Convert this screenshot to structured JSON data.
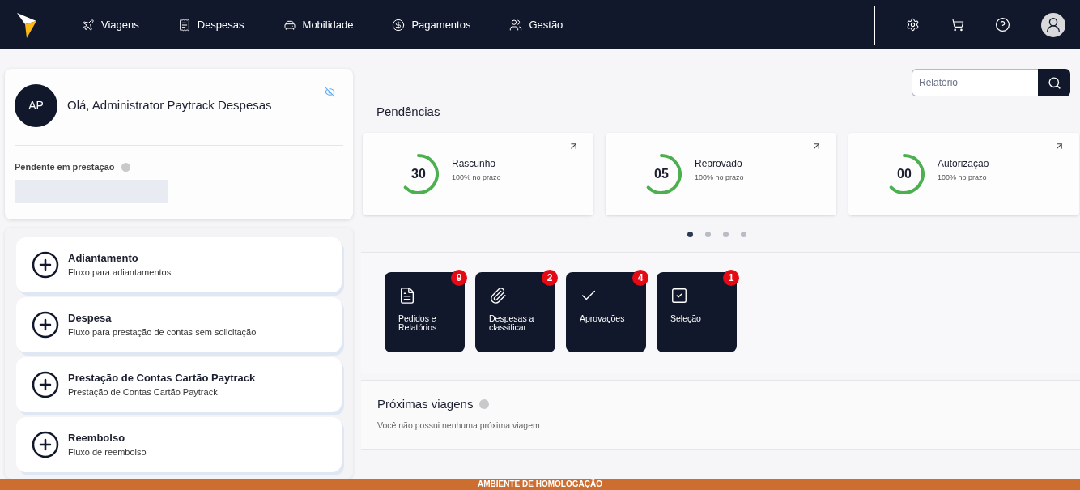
{
  "nav": [
    {
      "label": "Viagens"
    },
    {
      "label": "Despesas"
    },
    {
      "label": "Mobilidade"
    },
    {
      "label": "Pagamentos"
    },
    {
      "label": "Gestão"
    }
  ],
  "user": {
    "initials": "AP",
    "greeting": "Olá, Administrator Paytrack Despesas",
    "pending_label": "Pendente em prestação"
  },
  "flows": [
    {
      "title": "Adiantamento",
      "subtitle": "Fluxo para adiantamentos"
    },
    {
      "title": "Despesa",
      "subtitle": "Fluxo para prestação de contas sem solicitação"
    },
    {
      "title": "Prestação de Contas Cartão Paytrack",
      "subtitle": "Prestação de Contas Cartão Paytrack"
    },
    {
      "title": "Reembolso",
      "subtitle": "Fluxo de reembolso"
    }
  ],
  "search": {
    "placeholder": "Relatório"
  },
  "pendencias": {
    "title": "Pendências",
    "cards": [
      {
        "count": "30",
        "title": "Rascunho",
        "subtitle": "100% no prazo"
      },
      {
        "count": "05",
        "title": "Reprovado",
        "subtitle": "100% no prazo"
      },
      {
        "count": "00",
        "title": "Autorização",
        "subtitle": "100% no prazo"
      }
    ],
    "pages": [
      {
        "selected": true
      },
      {
        "selected": false
      },
      {
        "selected": false
      },
      {
        "selected": false
      }
    ]
  },
  "shortcuts": [
    {
      "label": "Pedidos e Relatórios",
      "badge": "9"
    },
    {
      "label": "Despesas a classificar",
      "badge": "2"
    },
    {
      "label": "Aprovações",
      "badge": "4"
    },
    {
      "label": "Seleção",
      "badge": "1"
    }
  ],
  "trips": {
    "title": "Próximas viagens",
    "empty": "Você não possui nenhuma próxima viagem"
  },
  "banner": "AMBIENTE DE HOMOLOGAÇÃO"
}
